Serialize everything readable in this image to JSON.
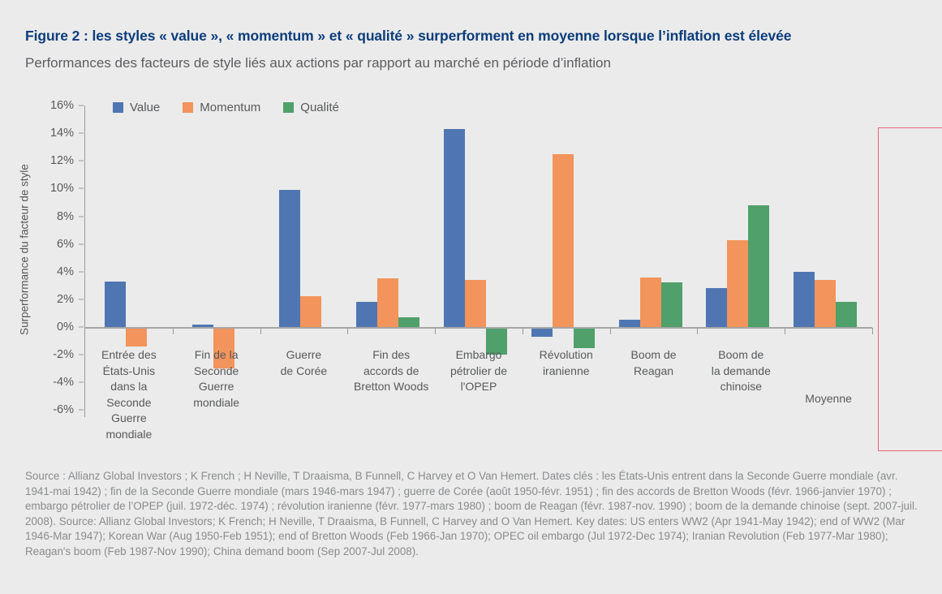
{
  "figure": {
    "title": "Figure 2 : les styles « value », « momentum » et « qualité » surperforment en moyenne lorsque l’inflation est élevée",
    "subtitle": "Performances des facteurs de style liés aux actions par rapport au marché en période d’inflation"
  },
  "source": {
    "text": "Source : Allianz Global Investors ; K French ; H Neville, T Draaisma, B Funnell, C Harvey et O Van Hemert. Dates clés : les États-Unis entrent dans la Seconde Guerre mondiale (avr. 1941-mai 1942) ; fin de la Seconde Guerre mondiale (mars 1946-mars 1947) ; guerre de Corée (août 1950-févr. 1951) ; fin des accords de Bretton Woods (févr. 1966-janvier 1970) ; embargo pétrolier de l’OPEP (juil. 1972-déc. 1974) ; révolution iranienne (févr. 1977-mars 1980) ; boom de Reagan (févr. 1987-nov. 1990) ; boom de la demande chinoise (sept. 2007-juil. 2008). Source: Allianz Global Investors; K French; H Neville, T Draaisma, B Funnell, C Harvey and O Van Hemert. Key dates: US enters WW2 (Apr 1941-May 1942); end of WW2 (Mar 1946-Mar 1947); Korean War (Aug 1950-Feb 1951); end of Bretton Woods (Feb 1966-Jan 1970); OPEC oil embargo (Jul 1972-Dec 1974); Iranian Revolution (Feb 1977-Mar 1980); Reagan's boom (Feb 1987-Nov 1990); China demand boom (Sep 2007-Jul 2008)."
  },
  "colors": {
    "value": "#4f76b2",
    "momentum": "#f2945b",
    "qualite": "#4fa06b",
    "title": "#0b3d7b",
    "highlight_box": "#e8657e",
    "background": "#ebebeb"
  },
  "chart_data": {
    "type": "bar",
    "title": "Figure 2 : les styles « value », « momentum » et « qualité » surperforment en moyenne lorsque l’inflation est élevée",
    "subtitle": "Performances des facteurs de style liés aux actions par rapport au marché en période d’inflation",
    "xlabel": "",
    "ylabel": "Surperformance du facteur de style",
    "ylim": [
      -6,
      16
    ],
    "ytick_step": 2,
    "ytick_labels": [
      "16%",
      "14%",
      "12%",
      "10%",
      "8%",
      "6%",
      "4%",
      "2%",
      "0%",
      "-2%",
      "-4%",
      "-6%"
    ],
    "ytick_values": [
      16,
      14,
      12,
      10,
      8,
      6,
      4,
      2,
      0,
      -2,
      -4,
      -6
    ],
    "unit": "%",
    "grid": false,
    "legend_position": "top-left",
    "categories": [
      "Entrée des\nÉtats-Unis\ndans la\nSeconde\nGuerre\nmondiale",
      "Fin de la\nSeconde\nGuerre\nmondiale",
      "Guerre\nde Corée",
      "Fin des\naccords de\nBretton Woods",
      "Embargo\npétrolier de\nl'OPEP",
      "Révolution\niranienne",
      "Boom de\nReagan",
      "Boom de\nla demande\nchinoise",
      "Moyenne"
    ],
    "series": [
      {
        "name": "Value",
        "color": "#4f76b2",
        "values": [
          3.3,
          0.2,
          9.9,
          1.8,
          14.3,
          -0.7,
          0.5,
          2.8,
          4.0
        ]
      },
      {
        "name": "Momentum",
        "color": "#f2945b",
        "values": [
          -1.4,
          -3.0,
          2.2,
          3.5,
          3.4,
          12.5,
          3.6,
          6.3,
          3.4
        ]
      },
      {
        "name": "Qualité",
        "color": "#4fa06b",
        "values": [
          null,
          null,
          null,
          0.7,
          -2.0,
          -1.5,
          3.2,
          8.8,
          1.8
        ]
      }
    ],
    "annotations": [
      {
        "type": "highlight-box",
        "category": "Moyenne",
        "color": "#e8657e"
      }
    ]
  },
  "legend": {
    "items": [
      {
        "label": "Value",
        "color": "#4f76b2",
        "icon": "legend-swatch"
      },
      {
        "label": "Momentum",
        "color": "#f2945b",
        "icon": "legend-swatch"
      },
      {
        "label": "Qualité",
        "color": "#4fa06b",
        "icon": "legend-swatch"
      }
    ]
  }
}
